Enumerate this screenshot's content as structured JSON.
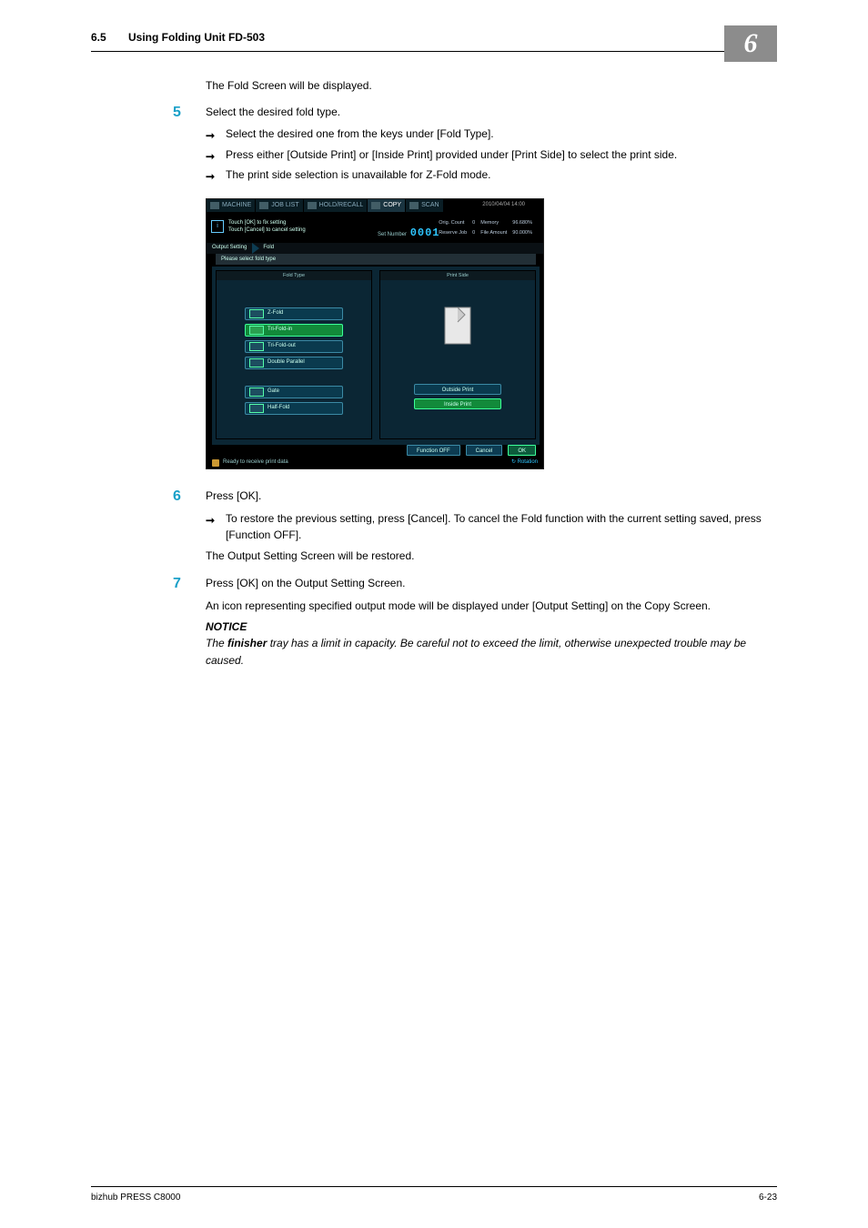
{
  "header": {
    "section_num": "6.5",
    "section_title": "Using Folding Unit FD-503",
    "chapter_num": "6"
  },
  "body": {
    "intro_para": "The Fold Screen will be displayed.",
    "step5": {
      "num": "5",
      "text": "Select the desired fold type.",
      "bullets": [
        "Select the desired one from the keys under [Fold Type].",
        "Press either [Outside Print] or [Inside Print] provided under [Print Side] to select the print side.",
        "The print side selection is unavailable for Z-Fold mode."
      ]
    },
    "step6": {
      "num": "6",
      "text": "Press [OK].",
      "bullet": "To restore the previous setting, press [Cancel]. To cancel the Fold function with the current setting saved, press [Function OFF].",
      "after": "The Output Setting Screen will be restored."
    },
    "step7": {
      "num": "7",
      "text": "Press [OK] on the Output Setting Screen.",
      "after": "An icon representing specified output mode will be displayed under [Output Setting] on the Copy Screen.",
      "notice_label": "NOTICE",
      "notice_text_pre": "The ",
      "notice_text_bold": "finisher",
      "notice_text_post": " tray has a limit in capacity. Be careful not to exceed the limit, otherwise unexpected trouble may be caused."
    }
  },
  "figure": {
    "tabs": {
      "machine": "MACHINE",
      "joblist": "JOB LIST",
      "holdrecall": "HOLD/RECALL",
      "copy": "COPY",
      "scan": "SCAN"
    },
    "datetime": "2010/04/04 14:00",
    "info_lines": "Touch [OK] to fix setting\nTouch [Cancel] to cancel setting",
    "set_number_label": "Set Number",
    "set_number_value": "0001",
    "counts": {
      "orig_count_label": "Orig. Count",
      "orig_count_val": "0",
      "reserve_label": "Reserve Job",
      "reserve_val": "0",
      "memory_label": "Memory",
      "memory_val": "96.680%",
      "file_label": "File Amount",
      "file_val": "90.000%"
    },
    "crumb": {
      "seg1": "Output Setting",
      "seg2": "Fold"
    },
    "subheader": "Please select fold type",
    "left_panel_header": "Fold Type",
    "right_panel_header": "Print Side",
    "fold_buttons": {
      "zfold": "Z-Fold",
      "trifoldin": "Tri-Fold-in",
      "trifoldout": "Tri-Fold-out",
      "doublepara": "Double Parallel",
      "gate": "Gate",
      "halffold": "Half-Fold"
    },
    "side_buttons": {
      "outside": "Outside Print",
      "inside": "Inside Print"
    },
    "bottom_buttons": {
      "funcoff": "Function OFF",
      "cancel": "Cancel",
      "ok": "OK"
    },
    "rotation": "Rotation",
    "status": "Ready to receive print data"
  },
  "footer": {
    "product": "bizhub PRESS C8000",
    "page": "6-23"
  }
}
